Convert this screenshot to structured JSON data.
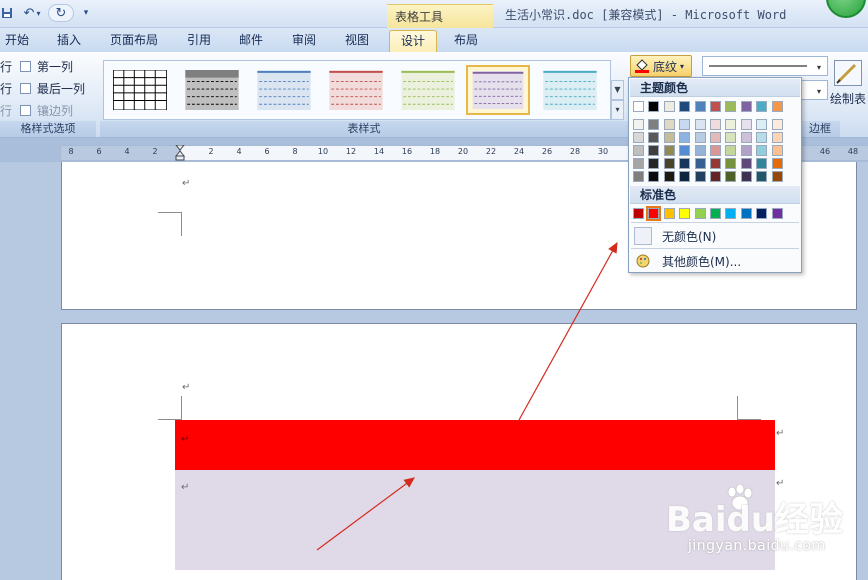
{
  "window": {
    "title": "生活小常识.doc [兼容模式] - Microsoft Word",
    "contextual_tab_group": "表格工具"
  },
  "tabs": [
    {
      "label": "开始"
    },
    {
      "label": "插入"
    },
    {
      "label": "页面布局"
    },
    {
      "label": "引用"
    },
    {
      "label": "邮件"
    },
    {
      "label": "审阅"
    },
    {
      "label": "视图"
    },
    {
      "label": "设计",
      "active": true
    },
    {
      "label": "布局"
    }
  ],
  "ribbon": {
    "style_options": {
      "items": [
        "行",
        "第一列",
        "行",
        "最后一列",
        "行",
        "镶边列"
      ],
      "caption": "格样式选项"
    },
    "table_styles_caption": "表样式",
    "shading_label": "底纹",
    "borders_caption": "边框",
    "draw_table_label": "绘制表"
  },
  "color_dropdown": {
    "theme_header": "主题颜色",
    "standard_header": "标准色",
    "no_color": "无颜色(N)",
    "more_colors": "其他颜色(M)...",
    "theme_colors_top": [
      "#ffffff",
      "#000000",
      "#eeece1",
      "#1f497d",
      "#4f81bd",
      "#c0504d",
      "#9bbb59",
      "#8064a2",
      "#4bacc6",
      "#f79646"
    ],
    "theme_colors_shades": [
      [
        "#f2f2f2",
        "#7f7f7f",
        "#ddd9c3",
        "#c6d9f0",
        "#dbe5f1",
        "#f2dcdb",
        "#ebf1dd",
        "#e5e0ec",
        "#dbeef3",
        "#fdeada"
      ],
      [
        "#d8d8d8",
        "#595959",
        "#c4bd97",
        "#8db3e2",
        "#b8cce4",
        "#e5b9b7",
        "#d7e3bc",
        "#ccc1d9",
        "#b7dde8",
        "#fbd5b5"
      ],
      [
        "#bfbfbf",
        "#3f3f3f",
        "#938953",
        "#548dd4",
        "#95b3d7",
        "#d99694",
        "#c3d69b",
        "#b2a2c7",
        "#92cddc",
        "#fac08f"
      ],
      [
        "#a5a5a5",
        "#262626",
        "#494429",
        "#17365d",
        "#366092",
        "#953734",
        "#76923c",
        "#5f497a",
        "#31859b",
        "#e36c09"
      ],
      [
        "#7f7f7f",
        "#0c0c0c",
        "#1d1b10",
        "#0f243e",
        "#244061",
        "#632423",
        "#4f6128",
        "#3f3151",
        "#205867",
        "#974806"
      ]
    ],
    "standard_colors": [
      "#c00000",
      "#ff0000",
      "#ffc000",
      "#ffff00",
      "#92d050",
      "#00b050",
      "#00b0f0",
      "#0070c0",
      "#002060",
      "#7030a0"
    ],
    "selected_standard_index": 1
  },
  "ruler": {
    "labels": [
      "8",
      "6",
      "4",
      "2",
      "2",
      "4",
      "6",
      "8",
      "10",
      "12",
      "14",
      "16",
      "18",
      "20",
      "22",
      "24",
      "26",
      "28",
      "30",
      "46",
      "48"
    ]
  },
  "document": {
    "paragraph_mark": "↵",
    "table_rows": [
      {
        "fill": "#ff0000"
      },
      {
        "fill": "#e0d9e8"
      }
    ]
  },
  "watermark": {
    "logo_text": "Baidu经验",
    "url": "jingyan.baidu.com"
  }
}
